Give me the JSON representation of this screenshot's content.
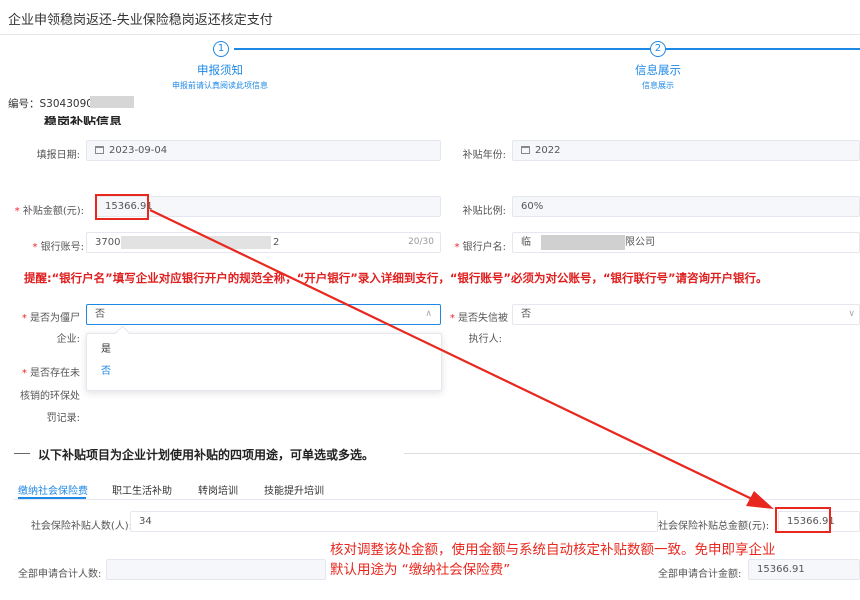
{
  "header": {
    "page_title": "企业申领稳岗返还-失业保险稳岗返还核定支付"
  },
  "steps": [
    {
      "number": "1",
      "title": "申报须知",
      "desc": "申报前请认真阅读此项信息"
    },
    {
      "number": "2",
      "title": "信息展示",
      "desc": "信息展示"
    }
  ],
  "serial": {
    "label": "编号：S304309047"
  },
  "section_partial_title": "稳岗补贴信息",
  "form": {
    "fill_date": {
      "label": "填报日期:",
      "value": "2023-09-04"
    },
    "subsidy_year": {
      "label": "补贴年份:",
      "value": "2022"
    },
    "subsidy_amount": {
      "label": "补贴金额(元):",
      "value": "15366.91"
    },
    "subsidy_ratio": {
      "label": "补贴比例:",
      "value": "60%"
    },
    "bank_account": {
      "label": "银行账号:",
      "value_prefix": "3700",
      "value_suffix": "2",
      "counter": "20/30"
    },
    "account_name": {
      "label": "银行户名:",
      "value_prefix": "临",
      "value_suffix": "限公司"
    },
    "zombie": {
      "label_line1": "是否为僵尸",
      "label_line2": "企业:",
      "value": "否"
    },
    "dishonest": {
      "label_line1": "是否失信被",
      "label_line2": "执行人:",
      "value": "否"
    },
    "env_penalty": {
      "label_line1": "是否存在未",
      "label_line2": "核销的环保处",
      "label_line3": "罚记录:"
    }
  },
  "warning": "提醒:“银行户名”填写企业对应银行开户的规范全称，“开户银行”录入详细到支行，“银行账号”必须为对公账号，“银行联行号”请咨询开户银行。",
  "dropdown": {
    "options": [
      "是",
      "否"
    ],
    "selected": "否"
  },
  "section2_title": "以下补贴项目为企业计划使用补贴的四项用途，可单选或多选。",
  "tabs": [
    "缴纳社会保险费",
    "职工生活补助",
    "转岗培训",
    "技能提升培训"
  ],
  "insurance": {
    "count_label": "社会保险补贴人数(人):",
    "count_value": "34",
    "total_label": "社会保险补贴总金额(元):",
    "total_value": "15366.91"
  },
  "totals": {
    "people_label": "全部申请合计人数:",
    "people_value": "",
    "amount_label": "全部申请合计金额:",
    "amount_value": "15366.91"
  },
  "annotation": {
    "line1": "核对调整该处金额，使用金额与系统自动核定补贴数额一致。免申即享企业",
    "line2": "默认用途为 “缴纳社会保险费”"
  },
  "colors": {
    "primary": "#1e88e5",
    "annotation_red": "#e8281e",
    "warning_red": "#e02020"
  }
}
